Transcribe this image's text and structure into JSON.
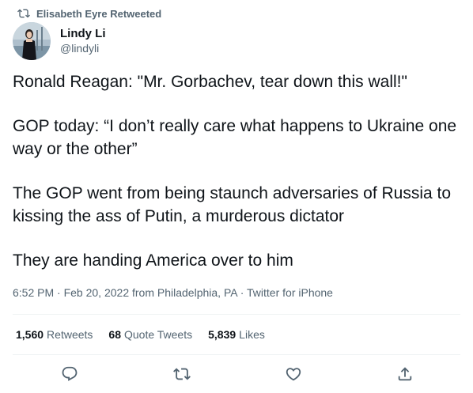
{
  "retweet_context": {
    "icon": "retweet-icon",
    "label": "Elisabeth Eyre Retweeted"
  },
  "author": {
    "display_name": "Lindy Li",
    "handle": "@lindyli",
    "avatar_icon": "avatar"
  },
  "tweet": {
    "paragraphs": [
      "Ronald Reagan: \"Mr. Gorbachev, tear down this wall!\"",
      "GOP today: “I don’t really care what happens to Ukraine one way or the other”",
      "The GOP went from being staunch adversaries of Russia to kissing the ass of Putin, a murderous dictator",
      "They are handing America over to him"
    ]
  },
  "meta": {
    "time": "6:52 PM",
    "separator": "·",
    "date": "Feb 20, 2022",
    "location": "from Philadelphia, PA",
    "source": "Twitter for iPhone"
  },
  "stats": {
    "retweets_count": "1,560",
    "retweets_label": "Retweets",
    "quotes_count": "68",
    "quotes_label": "Quote Tweets",
    "likes_count": "5,839",
    "likes_label": "Likes"
  },
  "actions": {
    "reply_icon": "reply-icon",
    "retweet_icon": "retweet-icon",
    "like_icon": "heart-icon",
    "share_icon": "share-icon"
  },
  "colors": {
    "text_primary": "#0f1419",
    "text_secondary": "#536471",
    "divider": "#eff3f4"
  }
}
